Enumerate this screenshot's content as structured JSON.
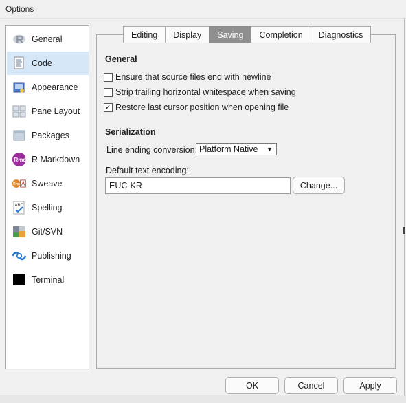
{
  "window": {
    "title": "Options"
  },
  "sidebar": {
    "items": [
      {
        "label": "General",
        "icon": "r-logo-icon",
        "active": false
      },
      {
        "label": "Code",
        "icon": "code-document-icon",
        "active": true
      },
      {
        "label": "Appearance",
        "icon": "appearance-icon",
        "active": false
      },
      {
        "label": "Pane Layout",
        "icon": "pane-layout-icon",
        "active": false
      },
      {
        "label": "Packages",
        "icon": "packages-icon",
        "active": false
      },
      {
        "label": "R Markdown",
        "icon": "rmarkdown-icon",
        "active": false
      },
      {
        "label": "Sweave",
        "icon": "sweave-icon",
        "active": false
      },
      {
        "label": "Spelling",
        "icon": "spelling-icon",
        "active": false
      },
      {
        "label": "Git/SVN",
        "icon": "git-icon",
        "active": false
      },
      {
        "label": "Publishing",
        "icon": "publishing-icon",
        "active": false
      },
      {
        "label": "Terminal",
        "icon": "terminal-icon",
        "active": false
      }
    ]
  },
  "tabs": [
    {
      "label": "Editing",
      "active": false
    },
    {
      "label": "Display",
      "active": false
    },
    {
      "label": "Saving",
      "active": true
    },
    {
      "label": "Completion",
      "active": false
    },
    {
      "label": "Diagnostics",
      "active": false
    }
  ],
  "general": {
    "title": "General",
    "options": [
      {
        "label": "Ensure that source files end with newline",
        "checked": false
      },
      {
        "label": "Strip trailing horizontal whitespace when saving",
        "checked": false
      },
      {
        "label": "Restore last cursor position when opening file",
        "checked": true
      }
    ]
  },
  "serialization": {
    "title": "Serialization",
    "line_ending_label": "Line ending conversion:",
    "line_ending_value": "Platform Native",
    "encoding_label": "Default text encoding:",
    "encoding_value": "EUC-KR",
    "change_button": "Change..."
  },
  "footer": {
    "ok": "OK",
    "cancel": "Cancel",
    "apply": "Apply"
  },
  "colors": {
    "active_item_bg": "#d6e7f8",
    "active_tab_bg": "#8f8f8f"
  }
}
